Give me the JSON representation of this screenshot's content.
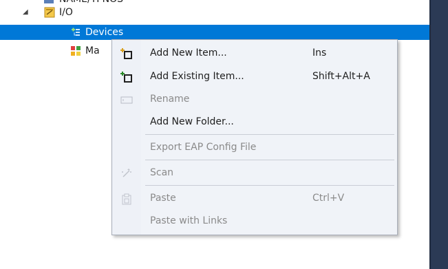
{
  "tree": {
    "nodes": [
      {
        "label": "NAME/TPNOS",
        "expander": "",
        "cut": true
      },
      {
        "label": "I/O",
        "expander": "◢"
      },
      {
        "label": "Devices",
        "selected": true
      },
      {
        "label": "Ma"
      }
    ]
  },
  "context_menu": {
    "items": [
      {
        "label": "Add New Item...",
        "shortcut": "Ins",
        "enabled": true,
        "icon": "add-new-item-icon"
      },
      {
        "label": "Add Existing Item...",
        "shortcut": "Shift+Alt+A",
        "enabled": true,
        "icon": "add-existing-item-icon"
      },
      {
        "label": "Rename",
        "shortcut": "",
        "enabled": false,
        "icon": "rename-icon"
      },
      {
        "label": "Add New Folder...",
        "shortcut": "",
        "enabled": true,
        "icon": ""
      },
      {
        "label": "Export EAP Config File",
        "shortcut": "",
        "enabled": false,
        "icon": ""
      },
      {
        "label": "Scan",
        "shortcut": "",
        "enabled": false,
        "icon": "scan-wand-icon"
      },
      {
        "label": "Paste",
        "shortcut": "Ctrl+V",
        "enabled": false,
        "icon": "paste-icon"
      },
      {
        "label": "Paste with Links",
        "shortcut": "",
        "enabled": false,
        "icon": ""
      }
    ]
  },
  "colors": {
    "selection": "#0078d7",
    "menu_background": "#f0f3f8",
    "side_panel": "#2b3a55"
  }
}
